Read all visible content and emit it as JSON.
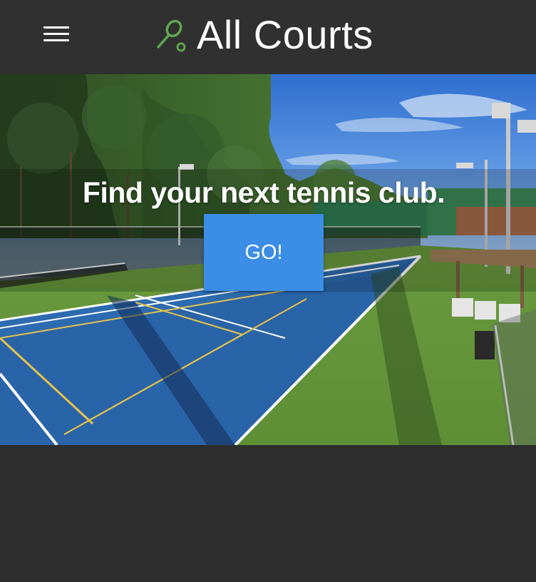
{
  "header": {
    "menu_icon": "hamburger-menu-icon",
    "logo_icon": "tennis-racket-icon",
    "title": "All Courts"
  },
  "hero": {
    "image": "tennis-court-photo",
    "heading": "Find your next tennis club.",
    "go_label": "GO!"
  },
  "colors": {
    "topbar": "#303030",
    "page_background": "#2d2d2d",
    "accent_green": "#5fa64f",
    "button_blue": "#3b8de6",
    "text": "#ffffff"
  }
}
